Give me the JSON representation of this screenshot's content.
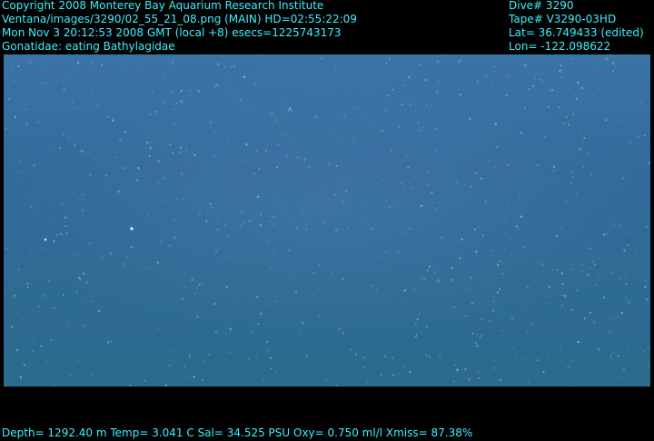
{
  "header_left": {
    "copyright": "Copyright 2008 Monterey Bay Aquarium Research Institute",
    "source": "Ventana/images/3290/02_55_21_08.png (MAIN)  HD=02:55:22:09",
    "datetime": "Mon Nov  3 20:12:53 2008 GMT (local +8)  esecs=1225743173",
    "annotation": "Gonatidae: eating Bathylagidae"
  },
  "header_right": {
    "dive": "Dive# 3290",
    "tape": "Tape# V3290-03HD",
    "lat": "Lat= 36.749433 (edited)",
    "lon": "Lon= -122.098622"
  },
  "footer": {
    "sensors": "Depth= 1292.40 m  Temp= 3.041 C  Sal= 34.525 PSU  Oxy= 0.750 ml/l  Xmiss= 87.38%"
  },
  "colors": {
    "overlay_text": "#3df0ff",
    "background": "#000000",
    "water": "#336b9b"
  }
}
